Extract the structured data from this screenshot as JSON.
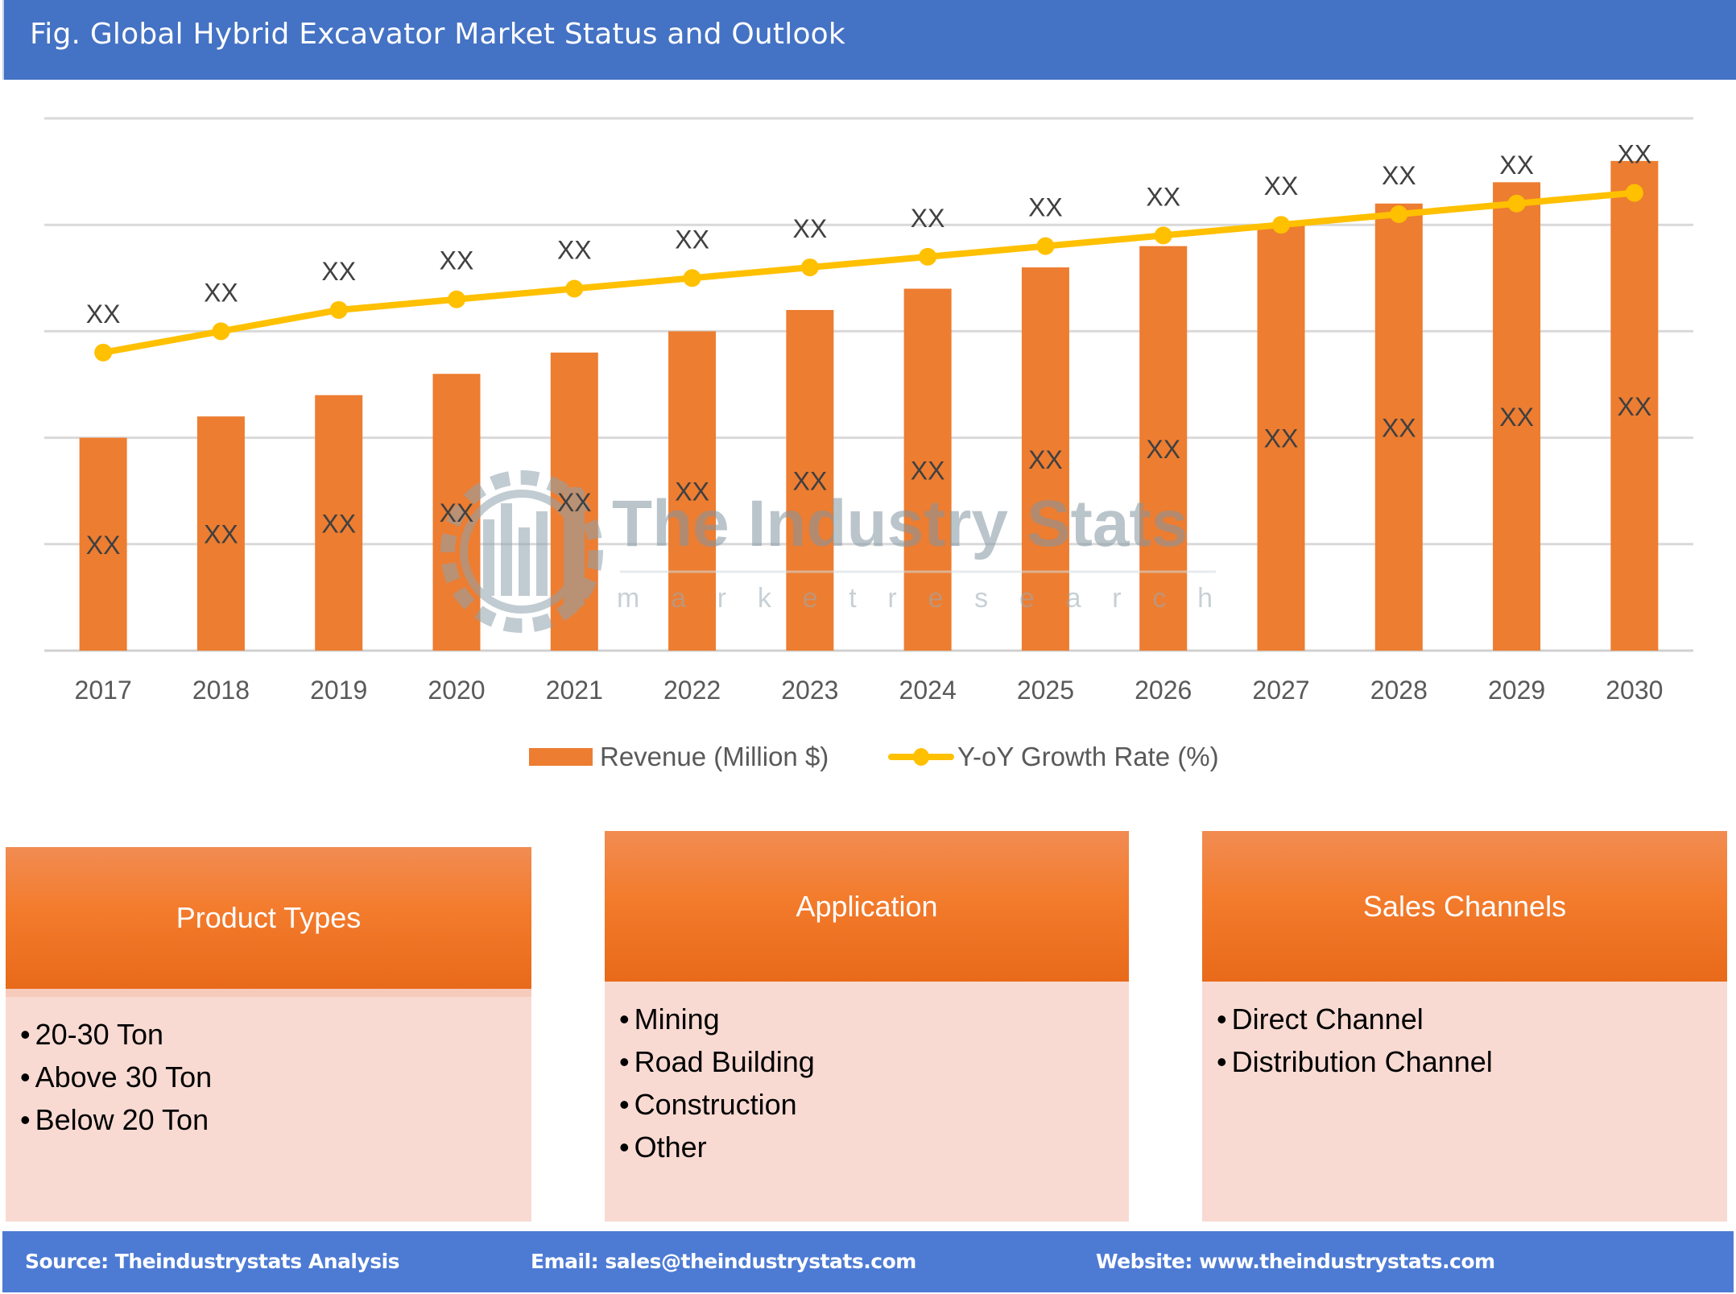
{
  "header": {
    "title": "Fig. Global Hybrid Excavator Market Status and Outlook"
  },
  "chart_data": {
    "type": "bar",
    "title": "Fig. Global Hybrid Excavator Market Status and Outlook",
    "xlabel": "",
    "ylabel": "",
    "categories": [
      "2017",
      "2018",
      "2019",
      "2020",
      "2021",
      "2022",
      "2023",
      "2024",
      "2025",
      "2026",
      "2027",
      "2028",
      "2029",
      "2030"
    ],
    "ylim": [
      0,
      100
    ],
    "grid": true,
    "y_tick_labels_visible": false,
    "legend_position": "bottom",
    "series": [
      {
        "name": "Revenue (Million $)",
        "type": "bar",
        "color": "#ED7D31",
        "values": [
          40,
          44,
          48,
          52,
          56,
          60,
          64,
          68,
          72,
          76,
          80,
          84,
          88,
          92
        ],
        "data_labels": [
          "XX",
          "XX",
          "XX",
          "XX",
          "XX",
          "XX",
          "XX",
          "XX",
          "XX",
          "XX",
          "XX",
          "XX",
          "XX",
          "XX"
        ],
        "note": "relative heights on an unlabeled axis; all values shown as XX"
      },
      {
        "name": "Y-oY Growth Rate (%)",
        "type": "line",
        "color": "#FFC000",
        "values": [
          56,
          60,
          64,
          66,
          68,
          70,
          72,
          74,
          76,
          78,
          80,
          82,
          84,
          86
        ],
        "data_labels": [
          "XX",
          "XX",
          "XX",
          "XX",
          "XX",
          "XX",
          "XX",
          "XX",
          "XX",
          "XX",
          "XX",
          "XX",
          "XX",
          "XX"
        ],
        "note": "relative positions on an unlabeled axis; all values shown as XX"
      }
    ]
  },
  "watermark": {
    "brand": "The Industry Stats",
    "tagline": "m a r k e t   r e s e a r c h"
  },
  "segments": [
    {
      "title": "Product Types",
      "items": [
        "20-30 Ton",
        "Above 30 Ton",
        "Below 20 Ton"
      ]
    },
    {
      "title": "Application",
      "items": [
        "Mining",
        "Road Building",
        "Construction",
        "Other"
      ]
    },
    {
      "title": "Sales Channels",
      "items": [
        "Direct Channel",
        "Distribution Channel"
      ]
    }
  ],
  "footer": {
    "source": "Source: Theindustrystats Analysis",
    "email": "Email: sales@theindustrystats.com",
    "website": "Website: www.theindustrystats.com"
  },
  "colors": {
    "header_bg": "#4472C4",
    "footer_bg": "#4D7BD4",
    "bar": "#ED7D31",
    "line": "#FFC000",
    "segment_body": "#F8DAD2"
  }
}
